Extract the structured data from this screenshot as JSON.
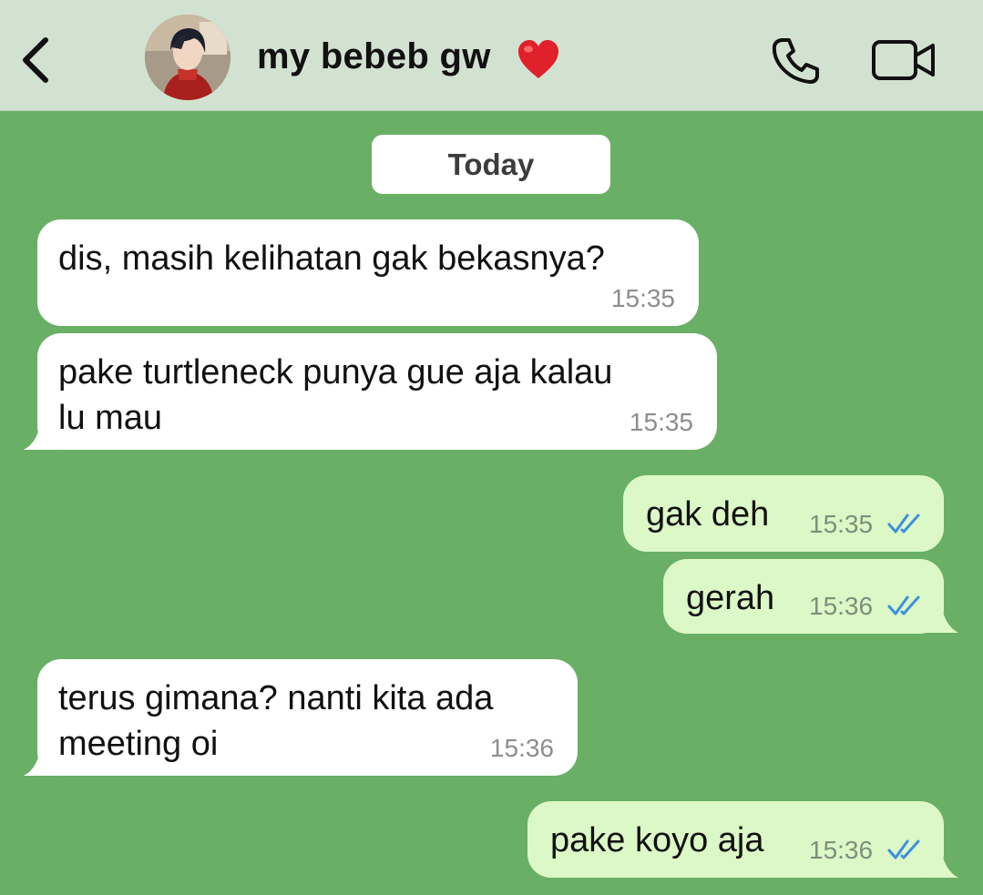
{
  "header": {
    "contact_name": "my bebeb gw",
    "contact_emoji": "heart",
    "back_icon": "chevron-left-icon",
    "call_icon": "phone-icon",
    "video_icon": "video-camera-icon"
  },
  "date_separator": "Today",
  "messages": [
    {
      "direction": "incoming",
      "line1": "dis, masih kelihatan gak bekasnya?",
      "line2": "",
      "time": "15:35"
    },
    {
      "direction": "incoming",
      "line1": "pake turtleneck punya gue aja kalau",
      "line2": "lu mau",
      "time": "15:35"
    },
    {
      "direction": "outgoing",
      "line1": "gak deh",
      "line2": "",
      "time": "15:35",
      "status": "read"
    },
    {
      "direction": "outgoing",
      "line1": "gerah",
      "line2": "",
      "time": "15:36",
      "status": "read"
    },
    {
      "direction": "incoming",
      "line1": "terus gimana? nanti kita ada",
      "line2": "meeting oi",
      "time": "15:36"
    },
    {
      "direction": "outgoing",
      "line1": "pake koyo aja",
      "line2": "",
      "time": "15:36",
      "status": "read"
    }
  ],
  "colors": {
    "chat_background": "#6aaf66",
    "header_background": "#d2e2d0",
    "incoming_bubble": "#ffffff",
    "outgoing_bubble": "#dcf8c6",
    "read_ticks": "#3d8fe0",
    "heart": "#e0202a"
  }
}
